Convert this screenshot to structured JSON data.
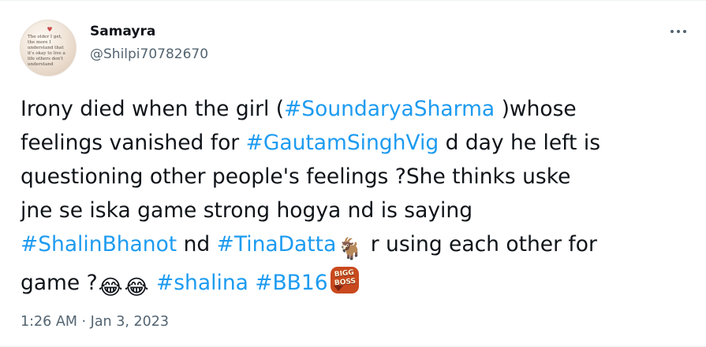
{
  "tweet": {
    "author": {
      "display_name": "Samayra",
      "handle": "@Shilpi70782670",
      "avatar_text": "The older I get,\nthe more I\nunderstand that\nit's okay to live a\nlife others don't\nunderstand"
    },
    "more_icon": "more-horizontal-icon",
    "body": {
      "line1": {
        "before": "Irony died when the girl (",
        "hashtag": "#SoundaryaSharma",
        "after": " )whose"
      },
      "line2": {
        "before": "feelings vanished for ",
        "hashtag": "#GautamSinghVig",
        "after": " d day he left is"
      },
      "line3": {
        "text": "questioning other people's feelings ?She thinks uske"
      },
      "line4": {
        "text": "jne se iska game strong hogya nd is saying"
      },
      "line5": {
        "hashtag1": "#ShalinBhanot",
        "middle": " nd ",
        "hashtag2": "#TinaDatta",
        "emoji": "🐐",
        "after": " r using each other for"
      },
      "line6": {
        "before": "game ?",
        "emoji1": "😂",
        "emoji2": "😂",
        "hashtag1": "#shalina",
        "hashtag2": "#BB16",
        "badge_text": "BIGG\nBOSS"
      }
    },
    "time": "1:26 AM",
    "separator": "·",
    "date": "Jan 3, 2023",
    "colors": {
      "text": "#0f1419",
      "secondary": "#536471",
      "link": "#1d9bf0",
      "badge": "#c9491e"
    }
  }
}
